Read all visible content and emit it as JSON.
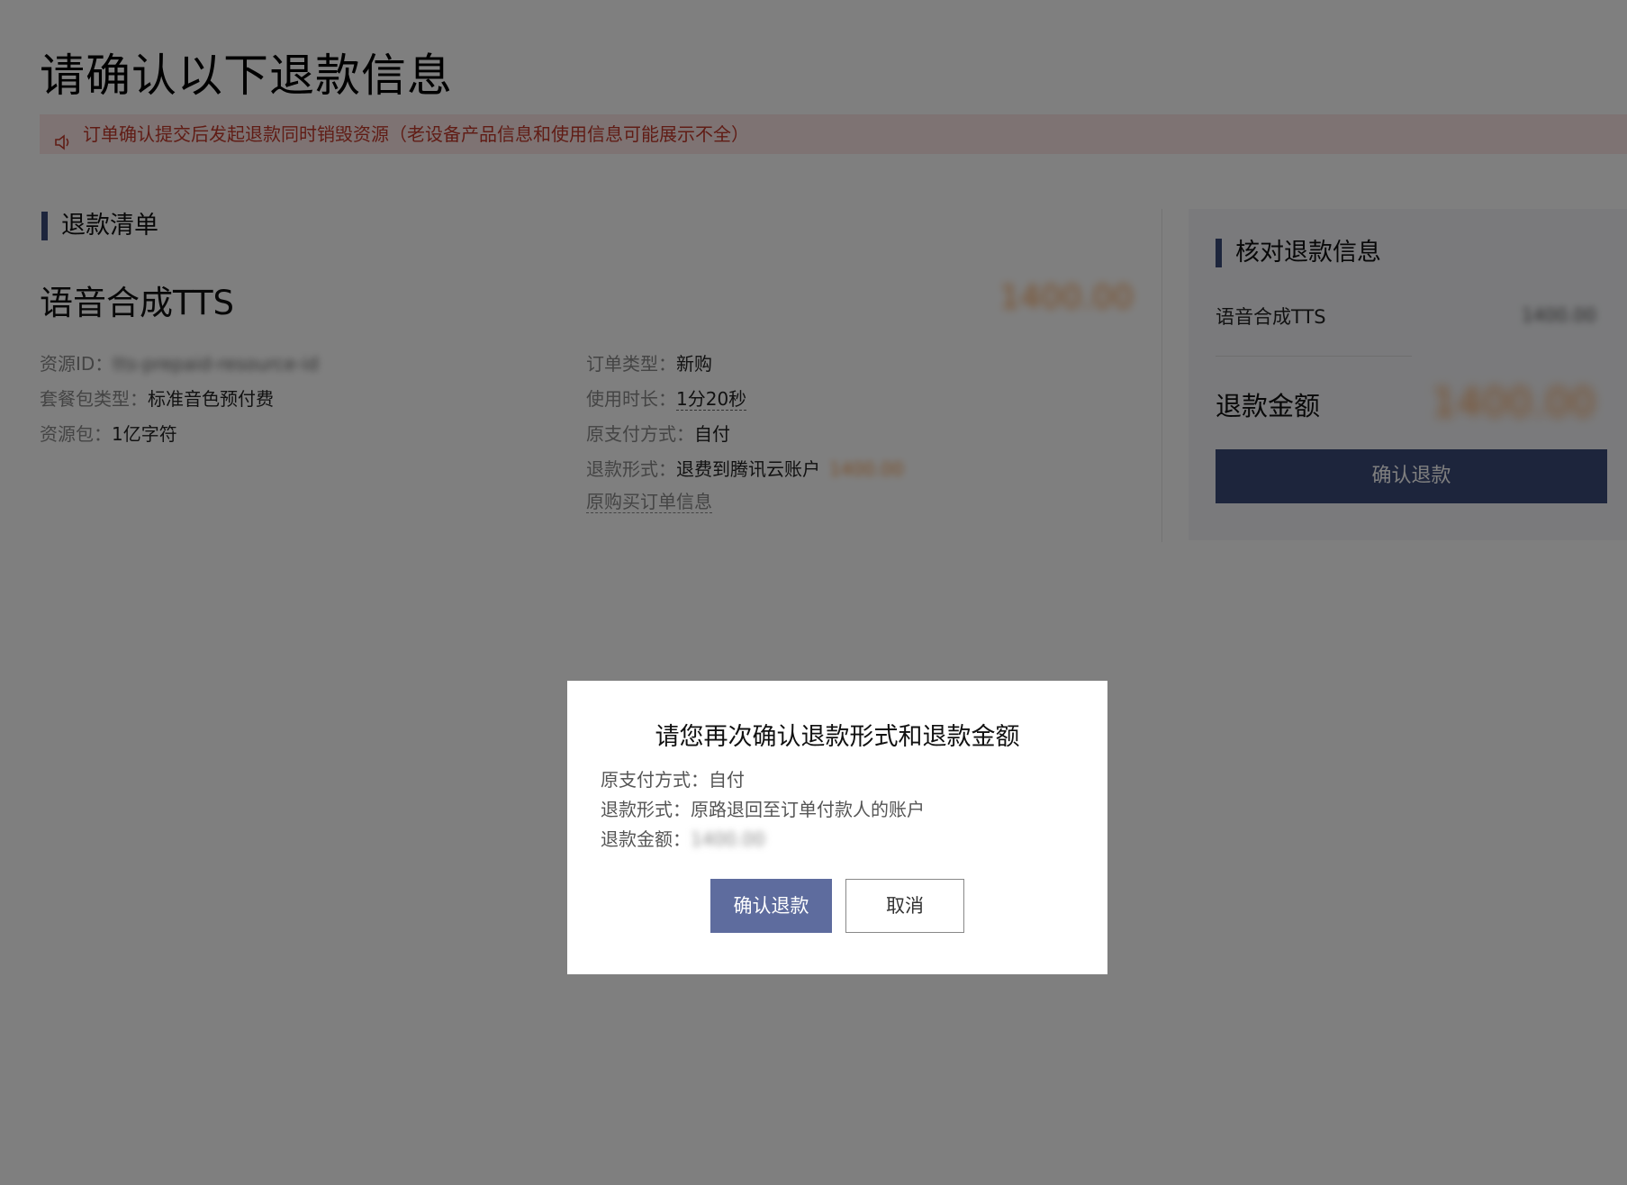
{
  "page": {
    "title": "请确认以下退款信息",
    "notice": "订单确认提交后发起退款同时销毁资源（老设备产品信息和使用信息可能展示不全）",
    "notice_icon": "speaker-icon"
  },
  "refund_list": {
    "heading": "退款清单",
    "product_name": "语音合成TTS",
    "product_price": "1400.00",
    "left_fields": [
      {
        "label": "资源ID：",
        "value": "tts-prepaid-resource-id",
        "blurred": true
      },
      {
        "label": "套餐包类型：",
        "value": "标准音色预付费"
      },
      {
        "label": "资源包：",
        "value": "1亿字符"
      }
    ],
    "right_fields": [
      {
        "label": "订单类型：",
        "value": "新购"
      },
      {
        "label": "使用时长：",
        "value": "1分20秒"
      },
      {
        "label": "原支付方式：",
        "value": "自付"
      },
      {
        "label": "退款形式：",
        "value": "退费到腾讯云账户",
        "extra": "1400.00"
      }
    ],
    "original_order_link": "原购买订单信息"
  },
  "summary": {
    "heading": "核对退款信息",
    "item_name": "语音合成TTS",
    "item_price": "1400.00",
    "total_label": "退款金额",
    "total_value": "1400.00",
    "confirm_button": "确认退款"
  },
  "modal": {
    "title": "请您再次确认退款形式和退款金额",
    "pay_label": "原支付方式：",
    "pay_value": "自付",
    "refund_form_label": "退款形式：",
    "refund_form_value": "原路退回至订单付款人的账户",
    "amount_label": "退款金额：",
    "amount_value": "1400.00",
    "confirm_button": "确认退款",
    "cancel_button": "取消"
  },
  "colors": {
    "accent": "#3b4a78",
    "price": "#f39a4c",
    "notice_text": "#c0392b",
    "notice_bg": "#fce7e7"
  }
}
